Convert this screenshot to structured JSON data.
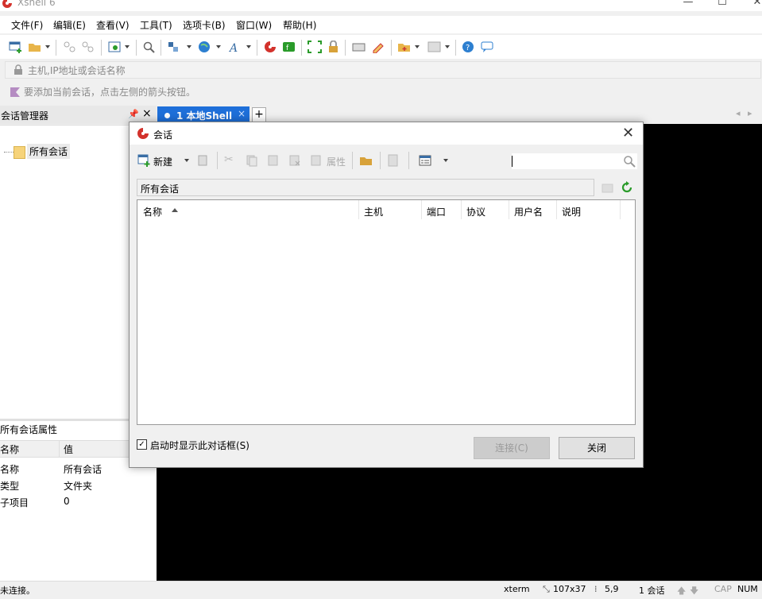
{
  "window": {
    "title": "Xshell 6"
  },
  "menu": [
    "文件(F)",
    "编辑(E)",
    "查看(V)",
    "工具(T)",
    "选项卡(B)",
    "窗口(W)",
    "帮助(H)"
  ],
  "address": {
    "placeholder": "主机,IP地址或会话名称"
  },
  "hint": "要添加当前会话，点击左侧的箭头按钮。",
  "session_manager": {
    "title": "会话管理器",
    "pin": "ᵖ",
    "close": "×",
    "tree_item": "所有会话"
  },
  "properties": {
    "title": "所有会话属性",
    "col_name": "名称",
    "col_value": "值",
    "rows": [
      {
        "name": "名称",
        "value": "所有会话"
      },
      {
        "name": "类型",
        "value": "文件夹"
      },
      {
        "name": "子项目",
        "value": "0"
      }
    ]
  },
  "tabs": [
    {
      "label": "1 本地Shell",
      "close": "×"
    }
  ],
  "tab_add": "+",
  "dialog": {
    "title": "会话",
    "new_label": "新建",
    "props_label": "属性",
    "path": "所有会话",
    "columns": [
      "名称",
      "主机",
      "端口",
      "协议",
      "用户名",
      "说明"
    ],
    "checkbox_label": "启动时显示此对话框(S)",
    "connect_label": "连接(C)",
    "close_label": "关闭"
  },
  "status": {
    "left": "未连接。",
    "term": "xterm",
    "size": "107x37",
    "pos": "5,9",
    "sessions": "1 会话",
    "cap": "CAP",
    "num": "NUM"
  },
  "colors": {
    "accent": "#1e6fd9",
    "terminal": "#000000"
  }
}
